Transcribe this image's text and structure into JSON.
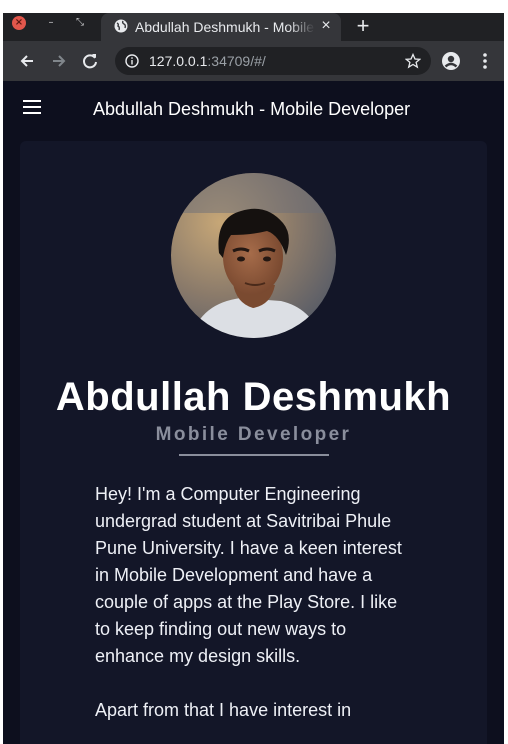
{
  "browser": {
    "tab_title": "Abdullah Deshmukh - Mobile Developer",
    "tab_close": "×",
    "new_tab": "+",
    "url_host": "127.0.0.1",
    "url_rest": ":34709/#/",
    "window_close": "×",
    "window_minimize": "–",
    "window_maximize": "⤡"
  },
  "appbar": {
    "title": "Abdullah Deshmukh - Mobile Developer",
    "menu_icon": "hamburger-icon"
  },
  "profile": {
    "name": "Abdullah Deshmukh",
    "role": "Mobile Developer",
    "bio": [
      "Hey! I'm a Computer Engineering undergrad student at Savitribai Phule Pune University. I have a keen interest in Mobile Development and have a couple of apps at the Play Store. I like to keep finding out new ways to enhance my design skills.",
      "Apart from that I have interest in"
    ]
  },
  "colors": {
    "page_bg": "#0d0f1e",
    "card_bg": "#131628",
    "role_text": "#8a8e9c",
    "chrome_bg": "#35363a",
    "tabstrip_bg": "#202124"
  }
}
